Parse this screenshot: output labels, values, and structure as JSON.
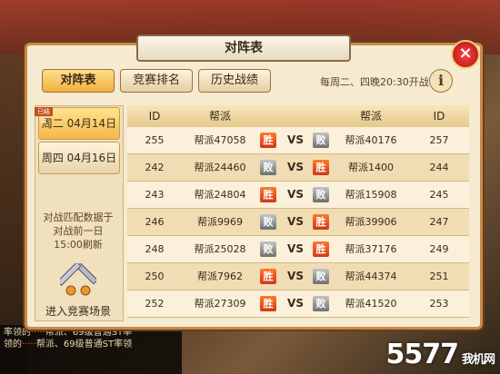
{
  "panel": {
    "title": "对阵表",
    "close_icon": "close-icon"
  },
  "tabs": [
    {
      "label": "对阵表",
      "active": true
    },
    {
      "label": "竞赛排名",
      "active": false
    },
    {
      "label": "历史战绩",
      "active": false
    }
  ],
  "schedule_text": "每周二、四晚20:30开战",
  "info_label": "i",
  "days": [
    {
      "label": "周二 04月14日",
      "active": true
    },
    {
      "label": "周四 04月16日",
      "active": false
    }
  ],
  "ribbon": "已结束",
  "note": "对战匹配数据于对战前一日15:00刷新",
  "enter_label": "进入竞赛场景",
  "table": {
    "headers": [
      "ID",
      "帮派",
      "帮派",
      "ID"
    ],
    "vs_label": "VS",
    "win_label": "胜",
    "lose_label": "败",
    "rows": [
      {
        "left_id": "255",
        "left_name": "帮派47058",
        "left_result": "win",
        "right_result": "lose",
        "right_name": "帮派40176",
        "right_id": "257"
      },
      {
        "left_id": "242",
        "left_name": "帮派24460",
        "left_result": "lose",
        "right_result": "win",
        "right_name": "帮派1400",
        "right_id": "244"
      },
      {
        "left_id": "243",
        "left_name": "帮派24804",
        "left_result": "win",
        "right_result": "lose",
        "right_name": "帮派15908",
        "right_id": "245"
      },
      {
        "left_id": "246",
        "left_name": "帮派9969",
        "left_result": "lose",
        "right_result": "win",
        "right_name": "帮派39906",
        "right_id": "247"
      },
      {
        "left_id": "248",
        "left_name": "帮派25028",
        "left_result": "lose",
        "right_result": "win",
        "right_name": "帮派37176",
        "right_id": "249"
      },
      {
        "left_id": "250",
        "left_name": "帮派7962",
        "left_result": "win",
        "right_result": "lose",
        "right_name": "帮派44374",
        "right_id": "251"
      },
      {
        "left_id": "252",
        "left_name": "帮派27309",
        "left_result": "win",
        "right_result": "lose",
        "right_name": "帮派41520",
        "right_id": "253"
      }
    ]
  },
  "chat": {
    "line1": "率领的",
    "line1b": "帮派、69级普通ST率",
    "line2": "领的",
    "line2b": "帮派、69级普通ST率领"
  },
  "watermark": {
    "main": "5577",
    "sub": "我机网"
  }
}
